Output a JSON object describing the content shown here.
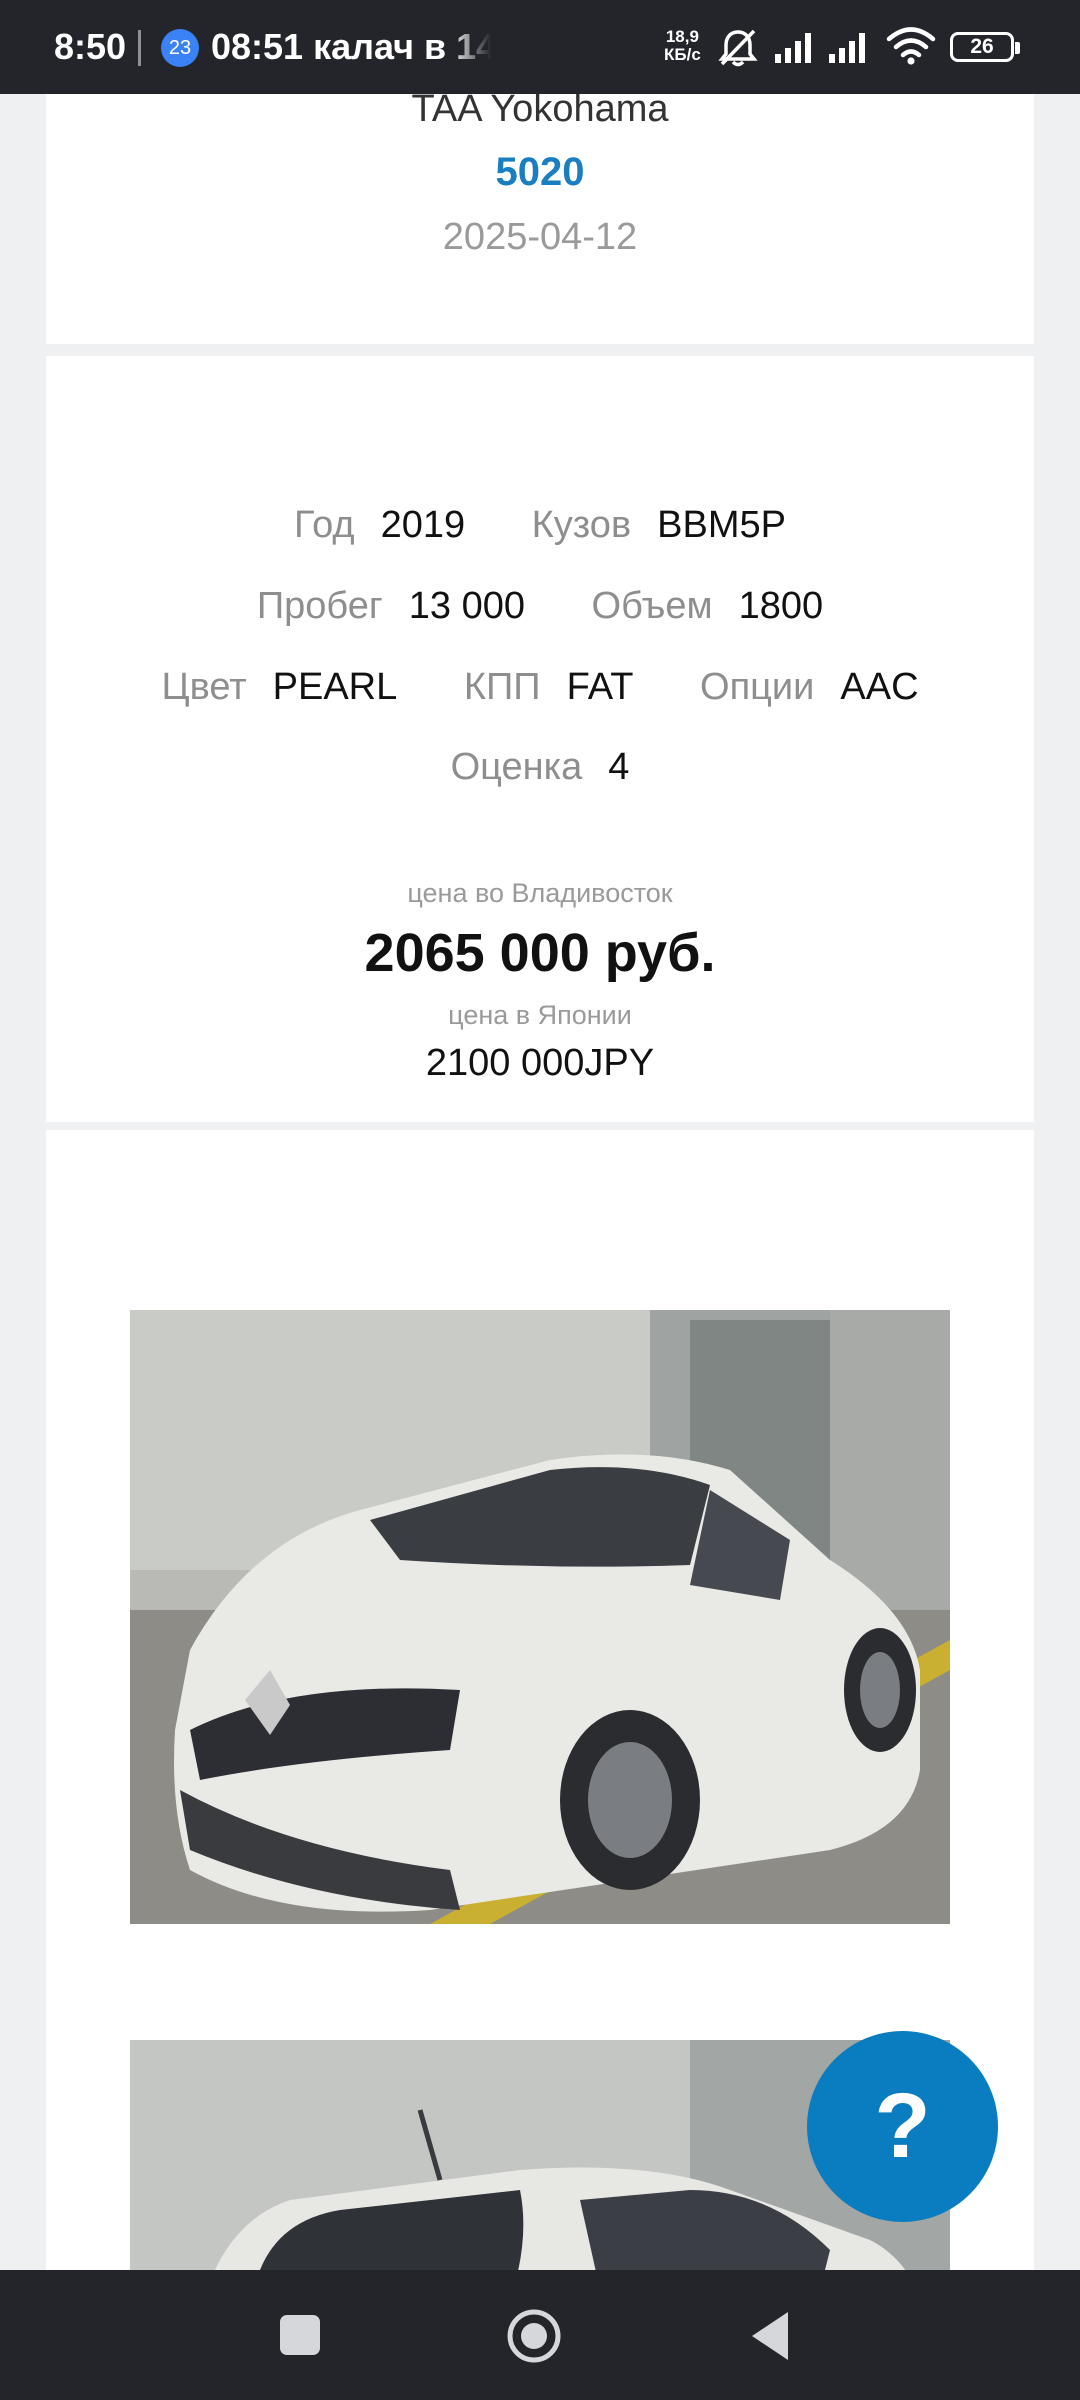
{
  "status_bar": {
    "time": "8:50",
    "notification_badge": "23",
    "notification_text": "08:51 калач в 14",
    "net_speed_value": "18,9",
    "net_speed_unit": "КБ/с",
    "battery": "26",
    "icons": [
      "mute-bell-icon",
      "signal-icon",
      "signal-icon",
      "wifi-icon",
      "battery-icon"
    ]
  },
  "lot": {
    "auction": "TAA Yokohama",
    "lot_number": "5020",
    "date": "2025-04-12"
  },
  "specs": {
    "year_label": "Год",
    "year": "2019",
    "body_label": "Кузов",
    "body": "BBM5P",
    "mileage_label": "Пробег",
    "mileage": "13 000",
    "volume_label": "Объем",
    "volume": "1800",
    "color_label": "Цвет",
    "color": "PEARL",
    "gearbox_label": "КПП",
    "gearbox": "FAT",
    "options_label": "Опции",
    "options": "AAC",
    "grade_label": "Оценка",
    "grade": "4"
  },
  "price": {
    "vladivostok_caption": "цена во Владивосток",
    "vladivostok_price": "2065 000 руб.",
    "japan_caption": "цена в Японии",
    "japan_price": "2100 000JPY"
  },
  "help_button": "?",
  "navigation": {
    "icons": [
      "recent-apps-icon",
      "home-icon",
      "back-icon"
    ]
  },
  "colors": {
    "accent": "#1a7fc0",
    "help_button": "#0a7dc0",
    "system_bars": "#23252b"
  }
}
